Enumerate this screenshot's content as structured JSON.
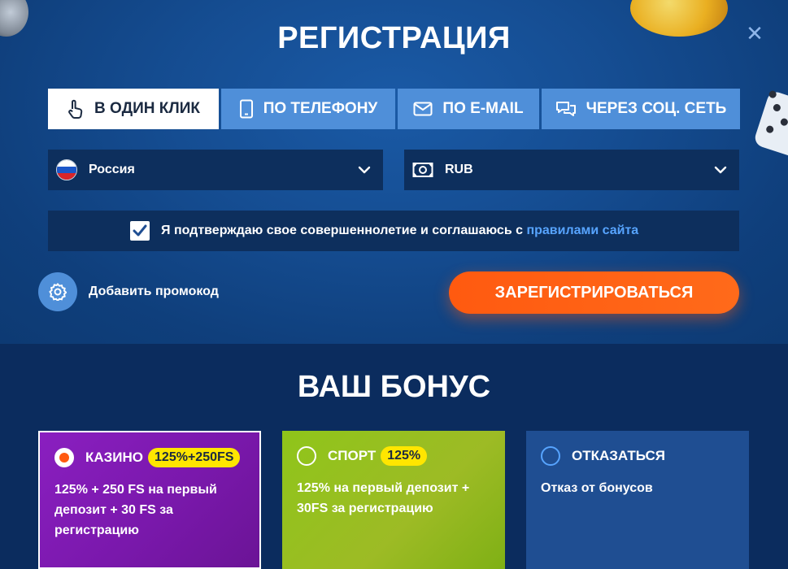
{
  "registration": {
    "title": "РЕГИСТРАЦИЯ",
    "close_icon": "close-icon",
    "tabs": [
      {
        "label": "В ОДИН КЛИК",
        "icon": "pointer-hand-icon",
        "active": true
      },
      {
        "label": "ПО ТЕЛЕФОНУ",
        "icon": "phone-icon",
        "active": false
      },
      {
        "label": "ПО E-MAIL",
        "icon": "envelope-icon",
        "active": false
      },
      {
        "label": "ЧЕРЕЗ СОЦ. СЕТЬ",
        "icon": "chat-bubbles-icon",
        "active": false
      }
    ],
    "country": {
      "value": "Россия",
      "icon": "russia-flag-icon"
    },
    "currency": {
      "value": "RUB",
      "icon": "banknote-icon"
    },
    "confirm": {
      "checked": true,
      "text": "Я подтверждаю свое совершеннолетие и соглашаюсь с ",
      "link": "правилами сайта"
    },
    "promo_label": "Добавить промокод",
    "submit_label": "ЗАРЕГИСТРИРОВАТЬСЯ"
  },
  "bonus": {
    "title": "ВАШ БОНУС",
    "cards": [
      {
        "name": "КАЗИНО",
        "badge": "125%+250FS",
        "desc": "125% + 250 FS на первый депозит + 30 FS за регистрацию",
        "selected": true
      },
      {
        "name": "СПОРТ",
        "badge": "125%",
        "desc": "125% на первый депозит + 30FS за регистрацию",
        "selected": false
      },
      {
        "name": "ОТКАЗАТЬСЯ",
        "badge": "",
        "desc": "Отказ от бонусов",
        "selected": false
      }
    ]
  },
  "colors": {
    "accent": "#ff5a10",
    "tab_bg": "#4f8fd9",
    "field_bg": "#0d2f5d",
    "badge": "#ffe600",
    "casino": "#8a1fc0",
    "sport": "#8fc51a",
    "refuse": "#1f4e92"
  }
}
